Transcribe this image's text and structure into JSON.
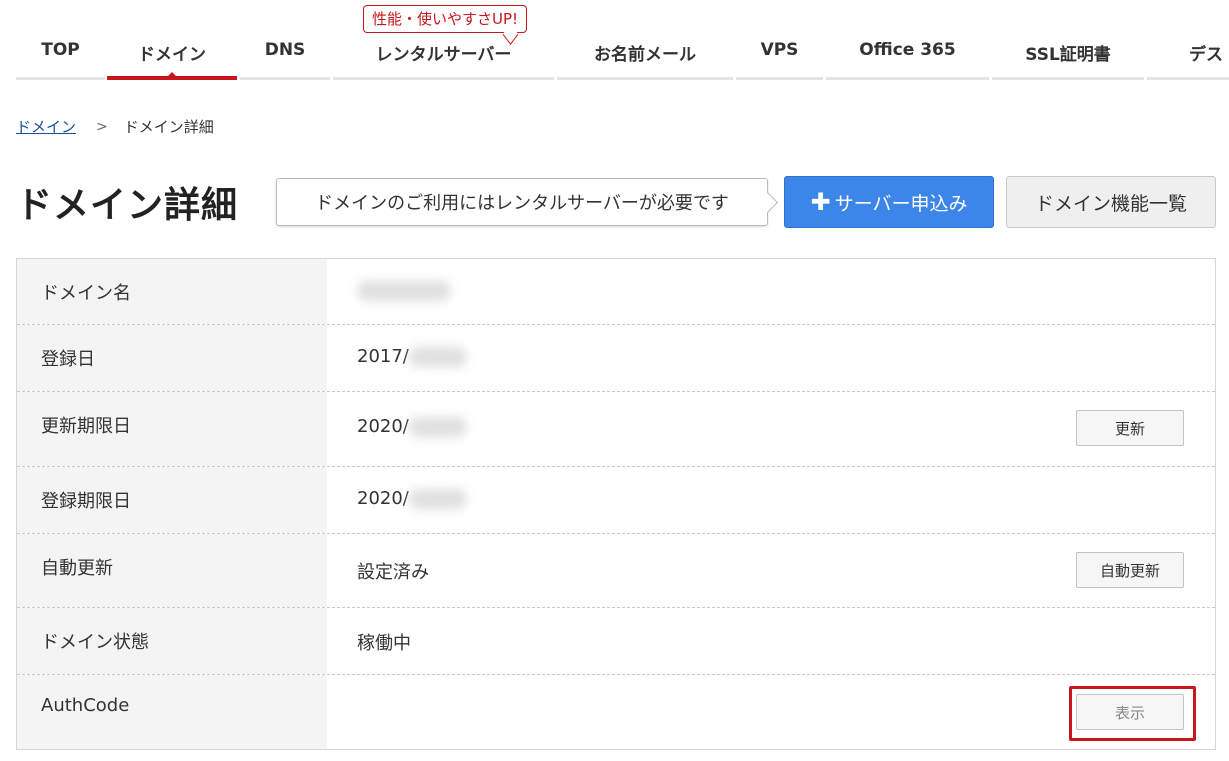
{
  "nav": {
    "badge": "性能・使いやすさUP!",
    "items": [
      {
        "label": "TOP"
      },
      {
        "label": "ドメイン"
      },
      {
        "label": "DNS"
      },
      {
        "label": "レンタルサーバー"
      },
      {
        "label": "お名前メール"
      },
      {
        "label": "VPS"
      },
      {
        "label": "Office 365"
      },
      {
        "label": "SSL証明書"
      },
      {
        "label": "デス"
      }
    ]
  },
  "breadcrumb": {
    "parent": "ドメイン",
    "separator": ">",
    "current": "ドメイン詳細"
  },
  "page": {
    "title": "ドメイン詳細",
    "notice": "ドメインのご利用にはレンタルサーバーが必要です",
    "server_button": "サーバー申込み",
    "features_button": "ドメイン機能一覧"
  },
  "detail": {
    "rows": [
      {
        "label": "ドメイン名",
        "value": ""
      },
      {
        "label": "登録日",
        "value": "2017/"
      },
      {
        "label": "更新期限日",
        "value": "2020/",
        "button": "更新"
      },
      {
        "label": "登録期限日",
        "value": "2020/"
      },
      {
        "label": "自動更新",
        "value": "設定済み",
        "button": "自動更新"
      },
      {
        "label": "ドメイン状態",
        "value": "稼働中"
      },
      {
        "label": "AuthCode",
        "value": "",
        "button": "表示"
      }
    ]
  },
  "colors": {
    "accent_red": "#c8161d",
    "primary_blue": "#3b86e8",
    "link_blue": "#1a4e9a"
  }
}
